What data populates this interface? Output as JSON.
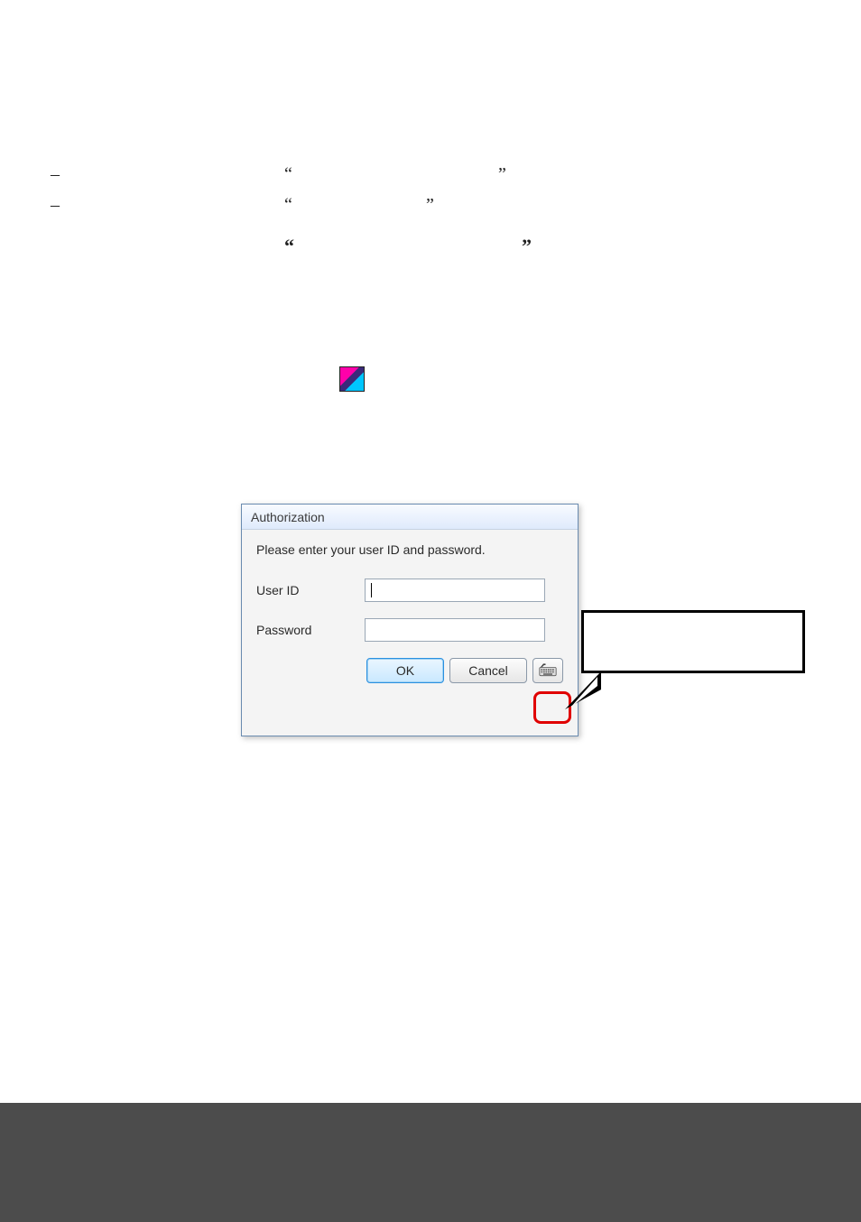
{
  "marks": {
    "dash": "–",
    "open_quote": "“",
    "close_quote": "”"
  },
  "app_icon_label": "",
  "dialog": {
    "title": "Authorization",
    "instruction": "Please enter your user ID and password.",
    "user_id_label": "User ID",
    "user_id_value": "",
    "password_label": "Password",
    "password_value": "",
    "ok_label": "OK",
    "cancel_label": "Cancel"
  },
  "callout_text": "",
  "colors": {
    "highlight": "#e00000",
    "ok_accent": "#2a90e0"
  }
}
